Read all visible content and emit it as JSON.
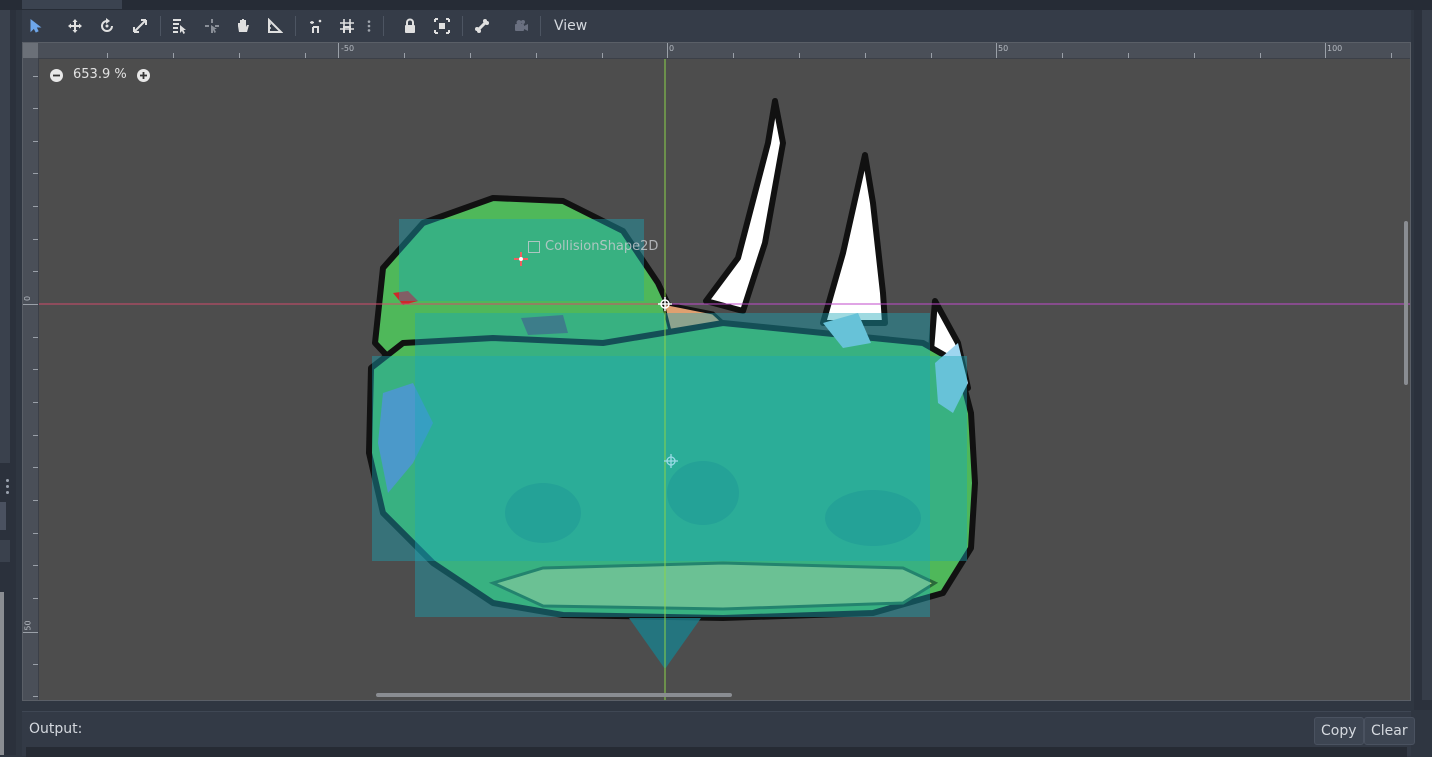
{
  "toolbar": {
    "tools": [
      {
        "name": "select-tool",
        "icon": "arrow-cursor-icon",
        "active": true
      },
      {
        "name": "move-tool",
        "icon": "move-arrows-icon"
      },
      {
        "name": "rotate-tool",
        "icon": "rotate-icon"
      },
      {
        "name": "scale-tool",
        "icon": "scale-icon"
      },
      {
        "name": "list-select-tool",
        "icon": "list-select-icon"
      },
      {
        "name": "pivot-tool",
        "icon": "pivot-icon"
      },
      {
        "name": "pan-tool",
        "icon": "hand-icon"
      },
      {
        "name": "ruler-tool",
        "icon": "ruler-icon"
      },
      {
        "name": "smart-snap-toggle",
        "icon": "snap-icon"
      },
      {
        "name": "grid-snap-toggle",
        "icon": "grid-snap-icon"
      },
      {
        "name": "snap-options-menu",
        "icon": "kebab-icon"
      },
      {
        "name": "lock-button",
        "icon": "lock-icon"
      },
      {
        "name": "group-button",
        "icon": "group-icon"
      },
      {
        "name": "skeleton-button",
        "icon": "bone-icon"
      },
      {
        "name": "camera-button",
        "icon": "camera-icon"
      }
    ],
    "view_label": "View"
  },
  "viewport": {
    "zoom_label": "653.9 %",
    "node_label": "CollisionShape2D",
    "ruler_top_labels": [
      "-50",
      "0",
      "50",
      "100"
    ],
    "ruler_left_labels": [
      "0",
      "50"
    ]
  },
  "output": {
    "label": "Output:",
    "copy_label": "Copy",
    "clear_label": "Clear"
  },
  "colors": {
    "viewport_bg": "#4d4d4d",
    "collision_shape": "#1aa6b7",
    "axis_x": "#d04a6a",
    "axis_y": "#8ad24a",
    "creature_green": "#4fb85a"
  }
}
